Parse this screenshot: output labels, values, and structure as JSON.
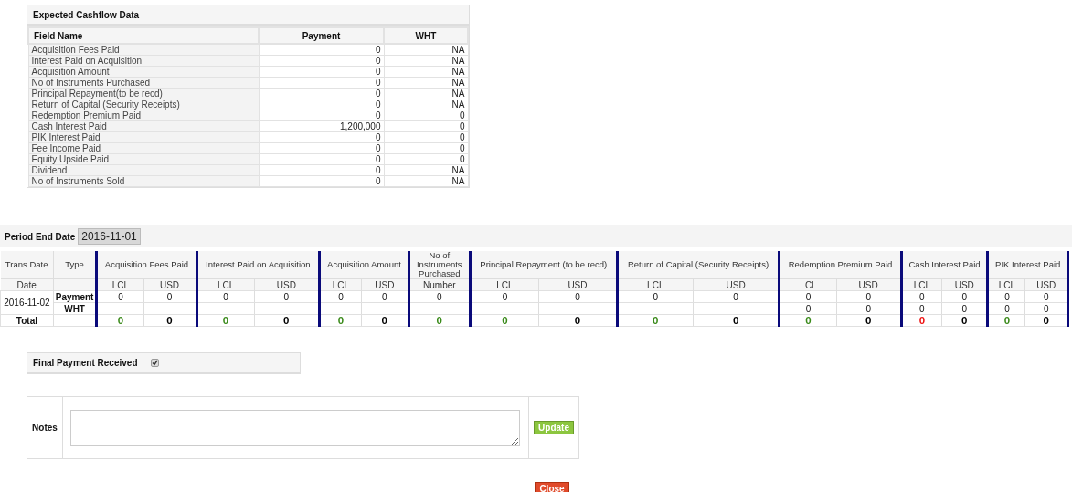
{
  "cashflow_panel": {
    "title": "Expected Cashflow Data",
    "columns": [
      "Field Name",
      "Payment",
      "WHT"
    ],
    "rows": [
      {
        "field": "Acquisition Fees Paid",
        "payment": "0",
        "wht": "NA"
      },
      {
        "field": "Interest Paid on Acquisition",
        "payment": "0",
        "wht": "NA"
      },
      {
        "field": "Acquisition Amount",
        "payment": "0",
        "wht": "NA"
      },
      {
        "field": "No of Instruments Purchased",
        "payment": "0",
        "wht": "NA"
      },
      {
        "field": "Principal Repayment(to be recd)",
        "payment": "0",
        "wht": "NA"
      },
      {
        "field": "Return of Capital (Security Receipts)",
        "payment": "0",
        "wht": "NA"
      },
      {
        "field": "Redemption Premium Paid",
        "payment": "0",
        "wht": "0"
      },
      {
        "field": "Cash Interest Paid",
        "payment": "1,200,000",
        "wht": "0"
      },
      {
        "field": "PIK Interest Paid",
        "payment": "0",
        "wht": "0"
      },
      {
        "field": "Fee Income Paid",
        "payment": "0",
        "wht": "0"
      },
      {
        "field": "Equity Upside Paid",
        "payment": "0",
        "wht": "0"
      },
      {
        "field": "Dividend",
        "payment": "0",
        "wht": "NA"
      },
      {
        "field": "No of Instruments Sold",
        "payment": "0",
        "wht": "NA"
      }
    ]
  },
  "period_end_date": {
    "label": "Period End Date",
    "value": "2016-11-01"
  },
  "transactions": {
    "fixed_columns": [
      {
        "label": "Trans Date",
        "sublabel": "Date"
      },
      {
        "label": "Type"
      }
    ],
    "groups": [
      {
        "label": "Acquisition Fees Paid",
        "subcolumns": [
          "LCL",
          "USD"
        ]
      },
      {
        "label": "Interest Paid on Acquisition",
        "subcolumns": [
          "LCL",
          "USD"
        ]
      },
      {
        "label": "Acquisition Amount",
        "subcolumns": [
          "LCL",
          "USD"
        ]
      },
      {
        "label": "No of Instruments Purchased",
        "subcolumns": [
          "Number"
        ]
      },
      {
        "label": "Principal Repayment (to be recd)",
        "subcolumns": [
          "LCL",
          "USD"
        ]
      },
      {
        "label": "Return of Capital (Security Receipts)",
        "subcolumns": [
          "LCL",
          "USD"
        ]
      },
      {
        "label": "Redemption Premium Paid",
        "subcolumns": [
          "LCL",
          "USD"
        ]
      },
      {
        "label": "Cash Interest Paid",
        "subcolumns": [
          "LCL",
          "USD"
        ]
      },
      {
        "label": "PIK Interest Paid",
        "subcolumns": [
          "LCL",
          "USD"
        ]
      }
    ],
    "date": "2016-11-02",
    "rows": [
      {
        "type": "Payment",
        "values": [
          "0",
          "0",
          "0",
          "0",
          "0",
          "0",
          "0",
          "0",
          "0",
          "0",
          "0",
          "0",
          "0",
          "0",
          "0",
          "0",
          "0"
        ]
      },
      {
        "type": "WHT",
        "values": [
          "0",
          "0",
          "0",
          "0",
          "0",
          "0"
        ]
      }
    ],
    "total": {
      "label": "Total",
      "values": [
        {
          "value": "0",
          "color": "#3a8a1a"
        },
        {
          "value": "0",
          "color": "#000000"
        },
        {
          "value": "0",
          "color": "#3a8a1a"
        },
        {
          "value": "0",
          "color": "#000000"
        },
        {
          "value": "0",
          "color": "#3a8a1a"
        },
        {
          "value": "0",
          "color": "#000000"
        },
        {
          "value": "0",
          "color": "#3a8a1a"
        },
        {
          "value": "0",
          "color": "#3a8a1a"
        },
        {
          "value": "0",
          "color": "#000000"
        },
        {
          "value": "0",
          "color": "#3a8a1a"
        },
        {
          "value": "0",
          "color": "#000000"
        },
        {
          "value": "0",
          "color": "#3a8a1a"
        },
        {
          "value": "0",
          "color": "#000000"
        },
        {
          "value": "0",
          "color": "#ee1111"
        },
        {
          "value": "0",
          "color": "#000000"
        },
        {
          "value": "0",
          "color": "#3a8a1a"
        },
        {
          "value": "0",
          "color": "#000000"
        }
      ]
    }
  },
  "final_payment": {
    "label": "Final Payment Received",
    "checked": true
  },
  "notes": {
    "label": "Notes",
    "button": "Update"
  },
  "close_button": "Close"
}
